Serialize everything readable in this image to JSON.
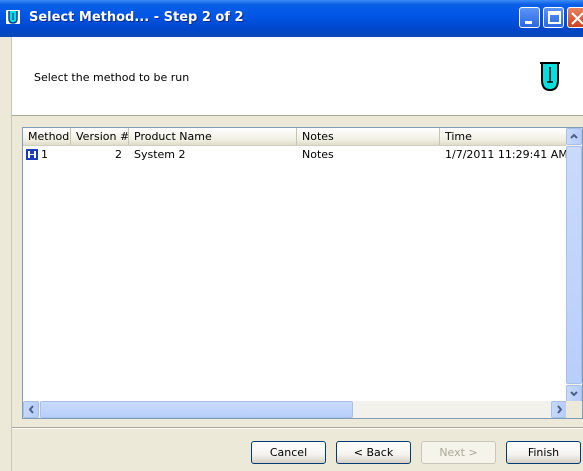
{
  "window": {
    "title": "Select Method... - Step 2 of 2"
  },
  "header": {
    "instruction": "Select the method to be run"
  },
  "table": {
    "columns": [
      "Method",
      "Version #",
      "Product Name",
      "Notes",
      "Time"
    ],
    "rows": [
      {
        "method": "1",
        "version": "2",
        "product_name": "System 2",
        "notes": "Notes",
        "time": "1/7/2011 11:29:41 AM"
      }
    ]
  },
  "buttons": {
    "cancel": "Cancel",
    "back": "< Back",
    "next": "Next >",
    "finish": "Finish"
  },
  "colors": {
    "title_bar": "#0055e5",
    "icon_cyan": "#00e0e0"
  }
}
